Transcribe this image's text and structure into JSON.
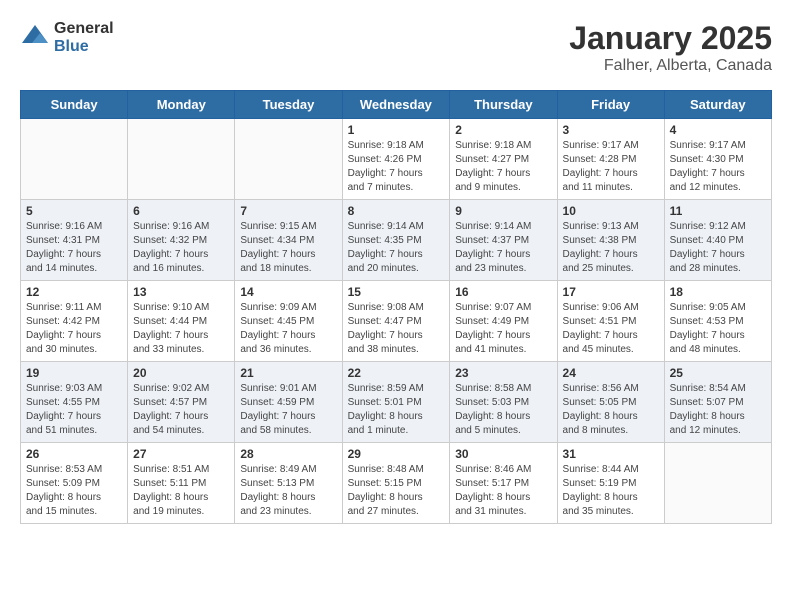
{
  "header": {
    "logo_general": "General",
    "logo_blue": "Blue",
    "month": "January 2025",
    "location": "Falher, Alberta, Canada"
  },
  "weekdays": [
    "Sunday",
    "Monday",
    "Tuesday",
    "Wednesday",
    "Thursday",
    "Friday",
    "Saturday"
  ],
  "weeks": [
    [
      {
        "day": "",
        "info": ""
      },
      {
        "day": "",
        "info": ""
      },
      {
        "day": "",
        "info": ""
      },
      {
        "day": "1",
        "info": "Sunrise: 9:18 AM\nSunset: 4:26 PM\nDaylight: 7 hours\nand 7 minutes."
      },
      {
        "day": "2",
        "info": "Sunrise: 9:18 AM\nSunset: 4:27 PM\nDaylight: 7 hours\nand 9 minutes."
      },
      {
        "day": "3",
        "info": "Sunrise: 9:17 AM\nSunset: 4:28 PM\nDaylight: 7 hours\nand 11 minutes."
      },
      {
        "day": "4",
        "info": "Sunrise: 9:17 AM\nSunset: 4:30 PM\nDaylight: 7 hours\nand 12 minutes."
      }
    ],
    [
      {
        "day": "5",
        "info": "Sunrise: 9:16 AM\nSunset: 4:31 PM\nDaylight: 7 hours\nand 14 minutes."
      },
      {
        "day": "6",
        "info": "Sunrise: 9:16 AM\nSunset: 4:32 PM\nDaylight: 7 hours\nand 16 minutes."
      },
      {
        "day": "7",
        "info": "Sunrise: 9:15 AM\nSunset: 4:34 PM\nDaylight: 7 hours\nand 18 minutes."
      },
      {
        "day": "8",
        "info": "Sunrise: 9:14 AM\nSunset: 4:35 PM\nDaylight: 7 hours\nand 20 minutes."
      },
      {
        "day": "9",
        "info": "Sunrise: 9:14 AM\nSunset: 4:37 PM\nDaylight: 7 hours\nand 23 minutes."
      },
      {
        "day": "10",
        "info": "Sunrise: 9:13 AM\nSunset: 4:38 PM\nDaylight: 7 hours\nand 25 minutes."
      },
      {
        "day": "11",
        "info": "Sunrise: 9:12 AM\nSunset: 4:40 PM\nDaylight: 7 hours\nand 28 minutes."
      }
    ],
    [
      {
        "day": "12",
        "info": "Sunrise: 9:11 AM\nSunset: 4:42 PM\nDaylight: 7 hours\nand 30 minutes."
      },
      {
        "day": "13",
        "info": "Sunrise: 9:10 AM\nSunset: 4:44 PM\nDaylight: 7 hours\nand 33 minutes."
      },
      {
        "day": "14",
        "info": "Sunrise: 9:09 AM\nSunset: 4:45 PM\nDaylight: 7 hours\nand 36 minutes."
      },
      {
        "day": "15",
        "info": "Sunrise: 9:08 AM\nSunset: 4:47 PM\nDaylight: 7 hours\nand 38 minutes."
      },
      {
        "day": "16",
        "info": "Sunrise: 9:07 AM\nSunset: 4:49 PM\nDaylight: 7 hours\nand 41 minutes."
      },
      {
        "day": "17",
        "info": "Sunrise: 9:06 AM\nSunset: 4:51 PM\nDaylight: 7 hours\nand 45 minutes."
      },
      {
        "day": "18",
        "info": "Sunrise: 9:05 AM\nSunset: 4:53 PM\nDaylight: 7 hours\nand 48 minutes."
      }
    ],
    [
      {
        "day": "19",
        "info": "Sunrise: 9:03 AM\nSunset: 4:55 PM\nDaylight: 7 hours\nand 51 minutes."
      },
      {
        "day": "20",
        "info": "Sunrise: 9:02 AM\nSunset: 4:57 PM\nDaylight: 7 hours\nand 54 minutes."
      },
      {
        "day": "21",
        "info": "Sunrise: 9:01 AM\nSunset: 4:59 PM\nDaylight: 7 hours\nand 58 minutes."
      },
      {
        "day": "22",
        "info": "Sunrise: 8:59 AM\nSunset: 5:01 PM\nDaylight: 8 hours\nand 1 minute."
      },
      {
        "day": "23",
        "info": "Sunrise: 8:58 AM\nSunset: 5:03 PM\nDaylight: 8 hours\nand 5 minutes."
      },
      {
        "day": "24",
        "info": "Sunrise: 8:56 AM\nSunset: 5:05 PM\nDaylight: 8 hours\nand 8 minutes."
      },
      {
        "day": "25",
        "info": "Sunrise: 8:54 AM\nSunset: 5:07 PM\nDaylight: 8 hours\nand 12 minutes."
      }
    ],
    [
      {
        "day": "26",
        "info": "Sunrise: 8:53 AM\nSunset: 5:09 PM\nDaylight: 8 hours\nand 15 minutes."
      },
      {
        "day": "27",
        "info": "Sunrise: 8:51 AM\nSunset: 5:11 PM\nDaylight: 8 hours\nand 19 minutes."
      },
      {
        "day": "28",
        "info": "Sunrise: 8:49 AM\nSunset: 5:13 PM\nDaylight: 8 hours\nand 23 minutes."
      },
      {
        "day": "29",
        "info": "Sunrise: 8:48 AM\nSunset: 5:15 PM\nDaylight: 8 hours\nand 27 minutes."
      },
      {
        "day": "30",
        "info": "Sunrise: 8:46 AM\nSunset: 5:17 PM\nDaylight: 8 hours\nand 31 minutes."
      },
      {
        "day": "31",
        "info": "Sunrise: 8:44 AM\nSunset: 5:19 PM\nDaylight: 8 hours\nand 35 minutes."
      },
      {
        "day": "",
        "info": ""
      }
    ]
  ]
}
